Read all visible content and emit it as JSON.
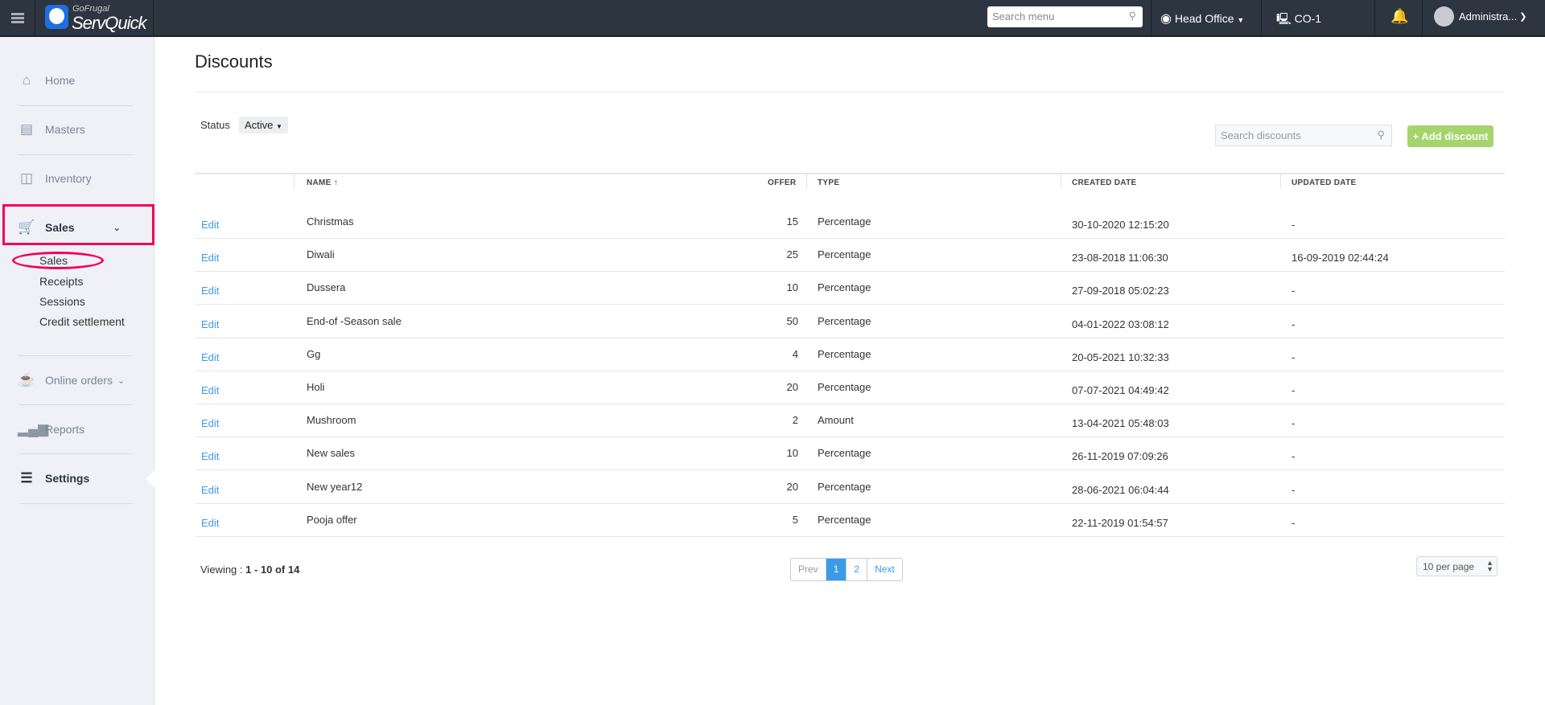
{
  "topbar": {
    "logo_top": "GoFrugal",
    "logo_main": "ServQuick",
    "search_placeholder": "Search menu",
    "location": "Head Office",
    "counter": "CO-1",
    "user": "Administra..."
  },
  "sidebar": {
    "items": [
      {
        "label": "Home"
      },
      {
        "label": "Masters"
      },
      {
        "label": "Inventory"
      },
      {
        "label": "Sales"
      },
      {
        "label": "Online orders"
      },
      {
        "label": "Reports"
      },
      {
        "label": "Settings"
      }
    ],
    "sales_sub": [
      "Sales",
      "Receipts",
      "Sessions",
      "Credit settlement"
    ]
  },
  "page": {
    "title": "Discounts",
    "status_label": "Status",
    "status_value": "Active",
    "search_placeholder": "Search discounts",
    "add_label": "+ Add discount"
  },
  "table": {
    "headers": {
      "name": "NAME",
      "offer": "OFFER",
      "type": "TYPE",
      "created": "CREATED DATE",
      "updated": "UPDATED DATE"
    },
    "edit_label": "Edit",
    "rows": [
      {
        "name": "Christmas",
        "offer": "15",
        "type": "Percentage",
        "created": "30-10-2020 12:15:20",
        "updated": "-"
      },
      {
        "name": "Diwali",
        "offer": "25",
        "type": "Percentage",
        "created": "23-08-2018 11:06:30",
        "updated": "16-09-2019 02:44:24"
      },
      {
        "name": "Dussera",
        "offer": "10",
        "type": "Percentage",
        "created": "27-09-2018 05:02:23",
        "updated": "-"
      },
      {
        "name": "End-of -Season sale",
        "offer": "50",
        "type": "Percentage",
        "created": "04-01-2022 03:08:12",
        "updated": "-"
      },
      {
        "name": "Gg",
        "offer": "4",
        "type": "Percentage",
        "created": "20-05-2021 10:32:33",
        "updated": "-"
      },
      {
        "name": "Holi",
        "offer": "20",
        "type": "Percentage",
        "created": "07-07-2021 04:49:42",
        "updated": "-"
      },
      {
        "name": "Mushroom",
        "offer": "2",
        "type": "Amount",
        "created": "13-04-2021 05:48:03",
        "updated": "-"
      },
      {
        "name": "New sales",
        "offer": "10",
        "type": "Percentage",
        "created": "26-11-2019 07:09:26",
        "updated": "-"
      },
      {
        "name": "New year12",
        "offer": "20",
        "type": "Percentage",
        "created": "28-06-2021 06:04:44",
        "updated": "-"
      },
      {
        "name": "Pooja offer",
        "offer": "5",
        "type": "Percentage",
        "created": "22-11-2019 01:54:57",
        "updated": "-"
      }
    ]
  },
  "footer": {
    "viewing_prefix": "Viewing : ",
    "viewing_range": "1 - 10 of 14",
    "prev": "Prev",
    "pages": [
      "1",
      "2"
    ],
    "next": "Next",
    "per_page": "10 per page"
  }
}
